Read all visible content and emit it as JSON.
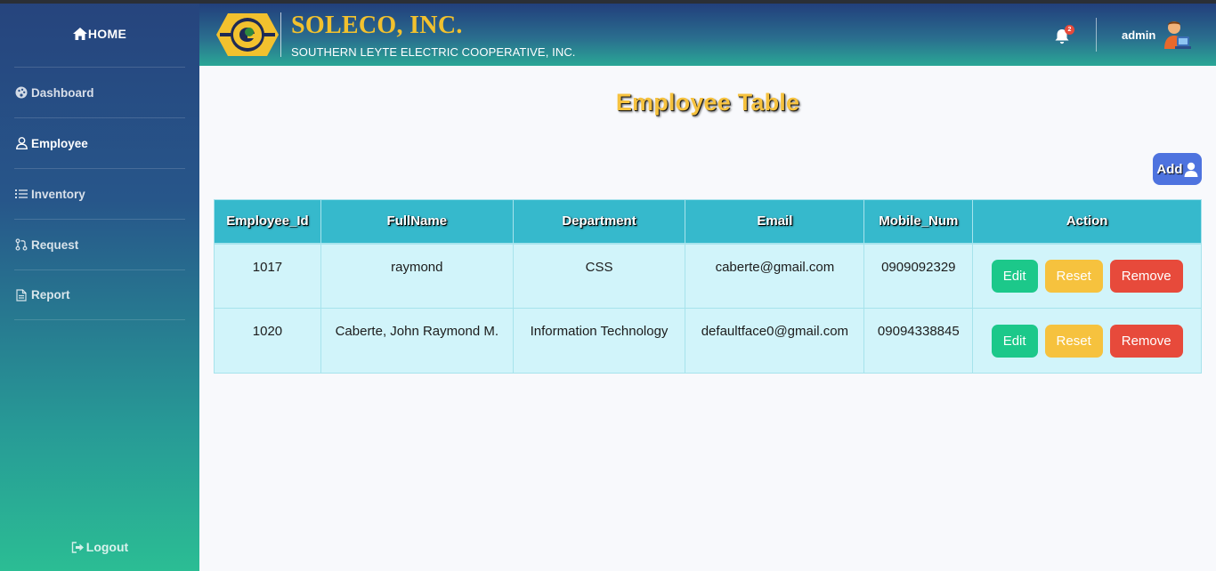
{
  "sidebar": {
    "home": "HOME",
    "items": [
      {
        "label": "Dashboard",
        "icon": "palette-icon"
      },
      {
        "label": "Employee",
        "icon": "user-icon"
      },
      {
        "label": "Inventory",
        "icon": "list-icon"
      },
      {
        "label": "Request",
        "icon": "request-icon"
      },
      {
        "label": "Report",
        "icon": "document-icon"
      }
    ],
    "logout": "Logout"
  },
  "header": {
    "brand_name": "SOLECO, INC.",
    "brand_sub": "SOUTHERN LEYTE ELECTRIC COOPERATIVE, INC.",
    "notification_count": "2",
    "user": "admin"
  },
  "main": {
    "title": "Employee Table",
    "add_label": "Add",
    "columns": [
      "Employee_Id",
      "FullName",
      "Department",
      "Email",
      "Mobile_Num",
      "Action"
    ],
    "rows": [
      {
        "id": "1017",
        "name": "raymond",
        "department": "CSS",
        "email": "caberte@gmail.com",
        "mobile": "0909092329"
      },
      {
        "id": "1020",
        "name": "Caberte, John Raymond M.",
        "department": "Information Technology",
        "email": "defaultface0@gmail.com",
        "mobile": "09094338845"
      }
    ],
    "actions": {
      "edit": "Edit",
      "reset": "Reset",
      "remove": "Remove"
    }
  },
  "colors": {
    "accent_blue": "#4e73df",
    "table_header": "#36b9cc",
    "row_bg": "#d1f4fa",
    "edit": "#1cc88a",
    "reset": "#f6c23e",
    "remove": "#e74a3b",
    "title": "#f6c23e"
  }
}
